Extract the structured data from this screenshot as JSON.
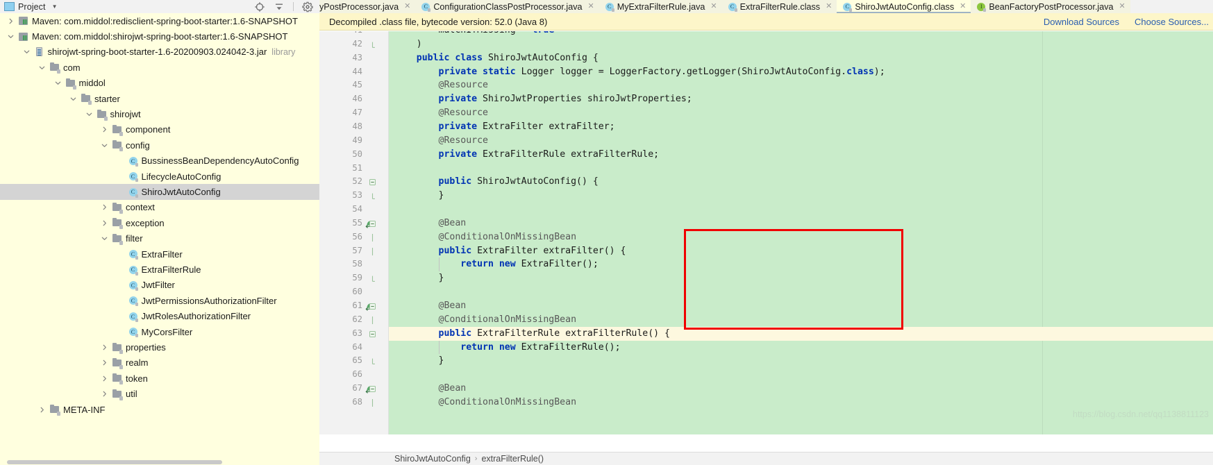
{
  "project_panel": {
    "title": "Project",
    "caret": "▼",
    "toolbar_icons": [
      "locate-icon",
      "collapse-all-icon",
      "settings-gear-icon"
    ],
    "tree": [
      {
        "indent": 0,
        "arrow": "right",
        "icon": "maven-module-icon",
        "label": "Maven: com.middol:redisclient-spring-boot-starter:1.6-SNAPSHOT",
        "sub": "",
        "selected": false
      },
      {
        "indent": 0,
        "arrow": "down",
        "icon": "maven-module-icon",
        "label": "Maven: com.middol:shirojwt-spring-boot-starter:1.6-SNAPSHOT",
        "sub": "",
        "selected": false
      },
      {
        "indent": 1,
        "arrow": "down",
        "icon": "jar-icon",
        "label": "shirojwt-spring-boot-starter-1.6-20200903.024042-3.jar",
        "sub": "library",
        "selected": false
      },
      {
        "indent": 2,
        "arrow": "down",
        "icon": "folder-icon",
        "label": "com",
        "sub": "",
        "selected": false
      },
      {
        "indent": 3,
        "arrow": "down",
        "icon": "folder-icon",
        "label": "middol",
        "sub": "",
        "selected": false
      },
      {
        "indent": 4,
        "arrow": "down",
        "icon": "folder-icon",
        "label": "starter",
        "sub": "",
        "selected": false
      },
      {
        "indent": 5,
        "arrow": "down",
        "icon": "folder-icon",
        "label": "shirojwt",
        "sub": "",
        "selected": false
      },
      {
        "indent": 6,
        "arrow": "right",
        "icon": "folder-icon",
        "label": "component",
        "sub": "",
        "selected": false
      },
      {
        "indent": 6,
        "arrow": "down",
        "icon": "folder-icon",
        "label": "config",
        "sub": "",
        "selected": false
      },
      {
        "indent": 7,
        "arrow": "none",
        "icon": "class-icon",
        "label": "BussinessBeanDependencyAutoConfig",
        "sub": "",
        "selected": false
      },
      {
        "indent": 7,
        "arrow": "none",
        "icon": "class-icon",
        "label": "LifecycleAutoConfig",
        "sub": "",
        "selected": false
      },
      {
        "indent": 7,
        "arrow": "none",
        "icon": "class-icon",
        "label": "ShiroJwtAutoConfig",
        "sub": "",
        "selected": true
      },
      {
        "indent": 6,
        "arrow": "right",
        "icon": "folder-icon",
        "label": "context",
        "sub": "",
        "selected": false
      },
      {
        "indent": 6,
        "arrow": "right",
        "icon": "folder-icon",
        "label": "exception",
        "sub": "",
        "selected": false
      },
      {
        "indent": 6,
        "arrow": "down",
        "icon": "folder-icon",
        "label": "filter",
        "sub": "",
        "selected": false
      },
      {
        "indent": 7,
        "arrow": "none",
        "icon": "class-icon",
        "label": "ExtraFilter",
        "sub": "",
        "selected": false
      },
      {
        "indent": 7,
        "arrow": "none",
        "icon": "class-icon",
        "label": "ExtraFilterRule",
        "sub": "",
        "selected": false
      },
      {
        "indent": 7,
        "arrow": "none",
        "icon": "class-icon",
        "label": "JwtFilter",
        "sub": "",
        "selected": false
      },
      {
        "indent": 7,
        "arrow": "none",
        "icon": "class-icon",
        "label": "JwtPermissionsAuthorizationFilter",
        "sub": "",
        "selected": false
      },
      {
        "indent": 7,
        "arrow": "none",
        "icon": "class-icon",
        "label": "JwtRolesAuthorizationFilter",
        "sub": "",
        "selected": false
      },
      {
        "indent": 7,
        "arrow": "none",
        "icon": "class-icon",
        "label": "MyCorsFilter",
        "sub": "",
        "selected": false
      },
      {
        "indent": 6,
        "arrow": "right",
        "icon": "folder-icon",
        "label": "properties",
        "sub": "",
        "selected": false
      },
      {
        "indent": 6,
        "arrow": "right",
        "icon": "folder-icon",
        "label": "realm",
        "sub": "",
        "selected": false
      },
      {
        "indent": 6,
        "arrow": "right",
        "icon": "folder-icon",
        "label": "token",
        "sub": "",
        "selected": false
      },
      {
        "indent": 6,
        "arrow": "right",
        "icon": "folder-icon",
        "label": "util",
        "sub": "",
        "selected": false
      },
      {
        "indent": 2,
        "arrow": "right",
        "icon": "folder-icon",
        "label": "META-INF",
        "sub": "",
        "selected": false
      }
    ]
  },
  "editor": {
    "tabs": [
      {
        "label": "yPostProcessor.java",
        "icon": "class-icon",
        "active": false,
        "truncated_left": true
      },
      {
        "label": "ConfigurationClassPostProcessor.java",
        "icon": "class-icon",
        "active": false
      },
      {
        "label": "MyExtraFilterRule.java",
        "icon": "class-icon",
        "active": false
      },
      {
        "label": "ExtraFilterRule.class",
        "icon": "class-icon",
        "active": false
      },
      {
        "label": "ShiroJwtAutoConfig.class",
        "icon": "class-icon",
        "active": true
      },
      {
        "label": "BeanFactoryPostProcessor.java",
        "icon": "interface-icon",
        "active": false
      }
    ],
    "close_glyph": "✕",
    "decompiled_bar": {
      "message": "Decompiled .class file, bytecode version: 52.0 (Java 8)",
      "links": [
        "Download Sources",
        "Choose Sources..."
      ]
    },
    "breadcrumb": {
      "items": [
        "ShiroJwtAutoConfig",
        "extraFilterRule()"
      ],
      "separator": "›"
    },
    "watermark": "https://blog.csdn.net/qq1138811123",
    "code": {
      "first_line_number": 41,
      "lines": [
        {
          "n": 41,
          "text": "        matchIfMissing = true",
          "tokens": [
            {
              "t": "        matchIfMissing = ",
              "c": "plain"
            },
            {
              "t": "true",
              "c": "kw"
            }
          ],
          "clipped_top": true
        },
        {
          "n": 42,
          "text": "    )",
          "tokens": [
            {
              "t": "    )",
              "c": "plain"
            }
          ],
          "fold": "end"
        },
        {
          "n": 43,
          "text": "    public class ShiroJwtAutoConfig {",
          "tokens": [
            {
              "t": "    ",
              "c": "plain"
            },
            {
              "t": "public class",
              "c": "kw"
            },
            {
              "t": " ShiroJwtAutoConfig {",
              "c": "plain"
            }
          ]
        },
        {
          "n": 44,
          "text": "        private static Logger logger = LoggerFactory.getLogger(ShiroJwtAutoConfig.class);",
          "tokens": [
            {
              "t": "        ",
              "c": "plain"
            },
            {
              "t": "private static",
              "c": "kw"
            },
            {
              "t": " Logger logger = LoggerFactory.getLogger(ShiroJwtAutoConfig.",
              "c": "plain"
            },
            {
              "t": "class",
              "c": "kw"
            },
            {
              "t": ");",
              "c": "plain"
            }
          ]
        },
        {
          "n": 45,
          "text": "        @Resource",
          "tokens": [
            {
              "t": "        @Resource",
              "c": "ann"
            }
          ]
        },
        {
          "n": 46,
          "text": "        private ShiroJwtProperties shiroJwtProperties;",
          "tokens": [
            {
              "t": "        ",
              "c": "plain"
            },
            {
              "t": "private",
              "c": "kw"
            },
            {
              "t": " ShiroJwtProperties shiroJwtProperties;",
              "c": "plain"
            }
          ]
        },
        {
          "n": 47,
          "text": "        @Resource",
          "tokens": [
            {
              "t": "        @Resource",
              "c": "ann"
            }
          ]
        },
        {
          "n": 48,
          "text": "        private ExtraFilter extraFilter;",
          "tokens": [
            {
              "t": "        ",
              "c": "plain"
            },
            {
              "t": "private",
              "c": "kw"
            },
            {
              "t": " ExtraFilter extraFilter;",
              "c": "plain"
            }
          ]
        },
        {
          "n": 49,
          "text": "        @Resource",
          "tokens": [
            {
              "t": "        @Resource",
              "c": "ann"
            }
          ]
        },
        {
          "n": 50,
          "text": "        private ExtraFilterRule extraFilterRule;",
          "tokens": [
            {
              "t": "        ",
              "c": "plain"
            },
            {
              "t": "private",
              "c": "kw"
            },
            {
              "t": " ExtraFilterRule extraFilterRule;",
              "c": "plain"
            }
          ]
        },
        {
          "n": 51,
          "text": "",
          "tokens": []
        },
        {
          "n": 52,
          "text": "        public ShiroJwtAutoConfig() {",
          "tokens": [
            {
              "t": "        ",
              "c": "plain"
            },
            {
              "t": "public",
              "c": "kw"
            },
            {
              "t": " ShiroJwtAutoConfig() {",
              "c": "plain"
            }
          ],
          "fold": "start"
        },
        {
          "n": 53,
          "text": "        }",
          "tokens": [
            {
              "t": "        }",
              "c": "plain"
            }
          ],
          "fold": "end"
        },
        {
          "n": 54,
          "text": "",
          "tokens": []
        },
        {
          "n": 55,
          "text": "        @Bean",
          "tokens": [
            {
              "t": "        @Bean",
              "c": "ann"
            }
          ],
          "gutter_icon": "override-method-icon",
          "fold": "start"
        },
        {
          "n": 56,
          "text": "        @ConditionalOnMissingBean",
          "tokens": [
            {
              "t": "        @ConditionalOnMissingBean",
              "c": "ann"
            }
          ],
          "fold": "mid"
        },
        {
          "n": 57,
          "text": "        public ExtraFilter extraFilter() {",
          "tokens": [
            {
              "t": "        ",
              "c": "plain"
            },
            {
              "t": "public",
              "c": "kw"
            },
            {
              "t": " ExtraFilter extraFilter() {",
              "c": "plain"
            }
          ],
          "fold": "mid"
        },
        {
          "n": 58,
          "text": "            return new ExtraFilter();",
          "tokens": [
            {
              "t": "            ",
              "c": "plain"
            },
            {
              "t": "return new",
              "c": "kw"
            },
            {
              "t": " ExtraFilter();",
              "c": "plain"
            }
          ]
        },
        {
          "n": 59,
          "text": "        }",
          "tokens": [
            {
              "t": "        }",
              "c": "plain"
            }
          ],
          "fold": "end"
        },
        {
          "n": 60,
          "text": "",
          "tokens": []
        },
        {
          "n": 61,
          "text": "        @Bean",
          "tokens": [
            {
              "t": "        @Bean",
              "c": "ann"
            }
          ],
          "gutter_icon": "override-method-icon",
          "fold": "start"
        },
        {
          "n": 62,
          "text": "        @ConditionalOnMissingBean",
          "tokens": [
            {
              "t": "        @ConditionalOnMissingBean",
              "c": "ann"
            }
          ],
          "fold": "mid"
        },
        {
          "n": 63,
          "text": "        public ExtraFilterRule extraFilterRule() {",
          "tokens": [
            {
              "t": "        ",
              "c": "plain"
            },
            {
              "t": "public",
              "c": "kw"
            },
            {
              "t": " ExtraFilterRule extraFilterRule() {",
              "c": "plain"
            }
          ],
          "caret": true,
          "fold": "start"
        },
        {
          "n": 64,
          "text": "            return new ExtraFilterRule();",
          "tokens": [
            {
              "t": "            ",
              "c": "plain"
            },
            {
              "t": "return new",
              "c": "kw"
            },
            {
              "t": " ExtraFilterRule();",
              "c": "plain"
            }
          ]
        },
        {
          "n": 65,
          "text": "        }",
          "tokens": [
            {
              "t": "        }",
              "c": "plain"
            }
          ],
          "fold": "end"
        },
        {
          "n": 66,
          "text": "",
          "tokens": []
        },
        {
          "n": 67,
          "text": "        @Bean",
          "tokens": [
            {
              "t": "        @Bean",
              "c": "ann"
            }
          ],
          "gutter_icon": "override-method-icon",
          "fold": "start"
        },
        {
          "n": 68,
          "text": "        @ConditionalOnMissingBean",
          "tokens": [
            {
              "t": "        @ConditionalOnMissingBean",
              "c": "ann"
            }
          ],
          "fold": "mid",
          "clipped_bottom": true
        }
      ]
    },
    "annotation_box": {
      "color": "#f00000",
      "covers_lines": [
        54,
        55,
        56,
        57,
        58,
        59,
        60
      ]
    }
  },
  "colors": {
    "editor_background": "#c9ecca",
    "panel_background": "#ffffdf",
    "selection": "#d4d4d4",
    "notification_bar": "#fdf6c9",
    "link": "#2a5db0",
    "keyword": "#0033b3",
    "annotation_box": "#f00000",
    "caret_line": "#fdf8df"
  }
}
